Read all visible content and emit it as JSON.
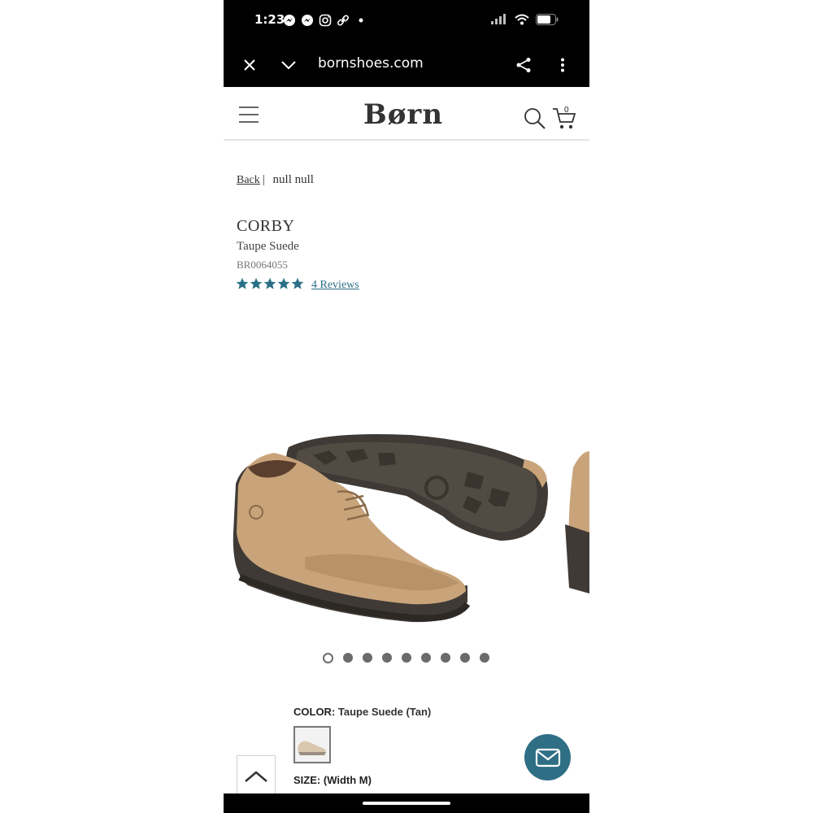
{
  "status_bar": {
    "time": "1:23",
    "left_icons": [
      "messenger-icon",
      "messenger-icon",
      "instagram-icon",
      "link-icon",
      "dot-icon"
    ],
    "right_icons": [
      "signal-icon",
      "wifi-icon",
      "battery-icon"
    ]
  },
  "browser": {
    "url": "bornshoes.com",
    "close_icon": "close-icon",
    "collapse_icon": "chevron-down-icon",
    "share_icon": "share-icon",
    "menu_icon": "more-vertical-icon"
  },
  "site_header": {
    "logo": "Børn",
    "cart_count": "0"
  },
  "breadcrumb": {
    "back": "Back",
    "separator": "|",
    "path": "null null"
  },
  "product": {
    "name": "CORBY",
    "color_name": "Taupe Suede",
    "sku": "BR0064055",
    "rating": 5,
    "rating_max": 5,
    "reviews_label": "4 Reviews"
  },
  "carousel": {
    "total_slides": 9,
    "active_index": 0
  },
  "options": {
    "color_label": "COLOR:",
    "color_value": "Taupe Suede (Tan)",
    "size_label": "SIZE:",
    "size_value": "(Width M)"
  },
  "colors": {
    "accent": "#2f6f86",
    "star": "#2a6f86",
    "shoe_suede": "#c9a47a",
    "sole": "#3f3a35"
  }
}
